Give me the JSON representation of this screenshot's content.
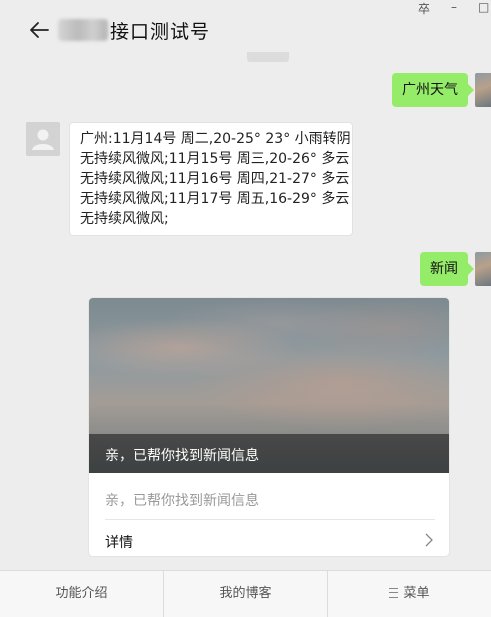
{
  "window": {
    "pin_glyph": "卒",
    "minimize_glyph": "–",
    "maximize_glyph": "□"
  },
  "header": {
    "title": "接口测试号"
  },
  "messages": {
    "user_weather": "广州天气",
    "bot_weather_lines": [
      "广州:11月14号 周二,20-25° 23° 小雨转阴",
      "无持续风微风;11月15号 周三,20-26° 多云",
      "无持续风微风;11月16号 周四,21-27° 多云",
      "无持续风微风;11月17号 周五,16-29° 多云",
      "无持续风微风;"
    ],
    "user_news": "新闻"
  },
  "news_card": {
    "caption": "亲，已帮你找到新闻信息",
    "description": "亲，已帮你找到新闻信息",
    "detail_label": "详情"
  },
  "footer": {
    "items": [
      "功能介绍",
      "我的博客",
      "菜单"
    ]
  },
  "colors": {
    "background": "#ededed",
    "my_bubble": "#95ec69",
    "bot_bubble": "#ffffff",
    "footer": "#f7f7f7"
  },
  "icons": [
    "back-arrow-icon",
    "default-avatar-icon",
    "chevron-right-icon",
    "menu-icon",
    "pin-icon"
  ]
}
